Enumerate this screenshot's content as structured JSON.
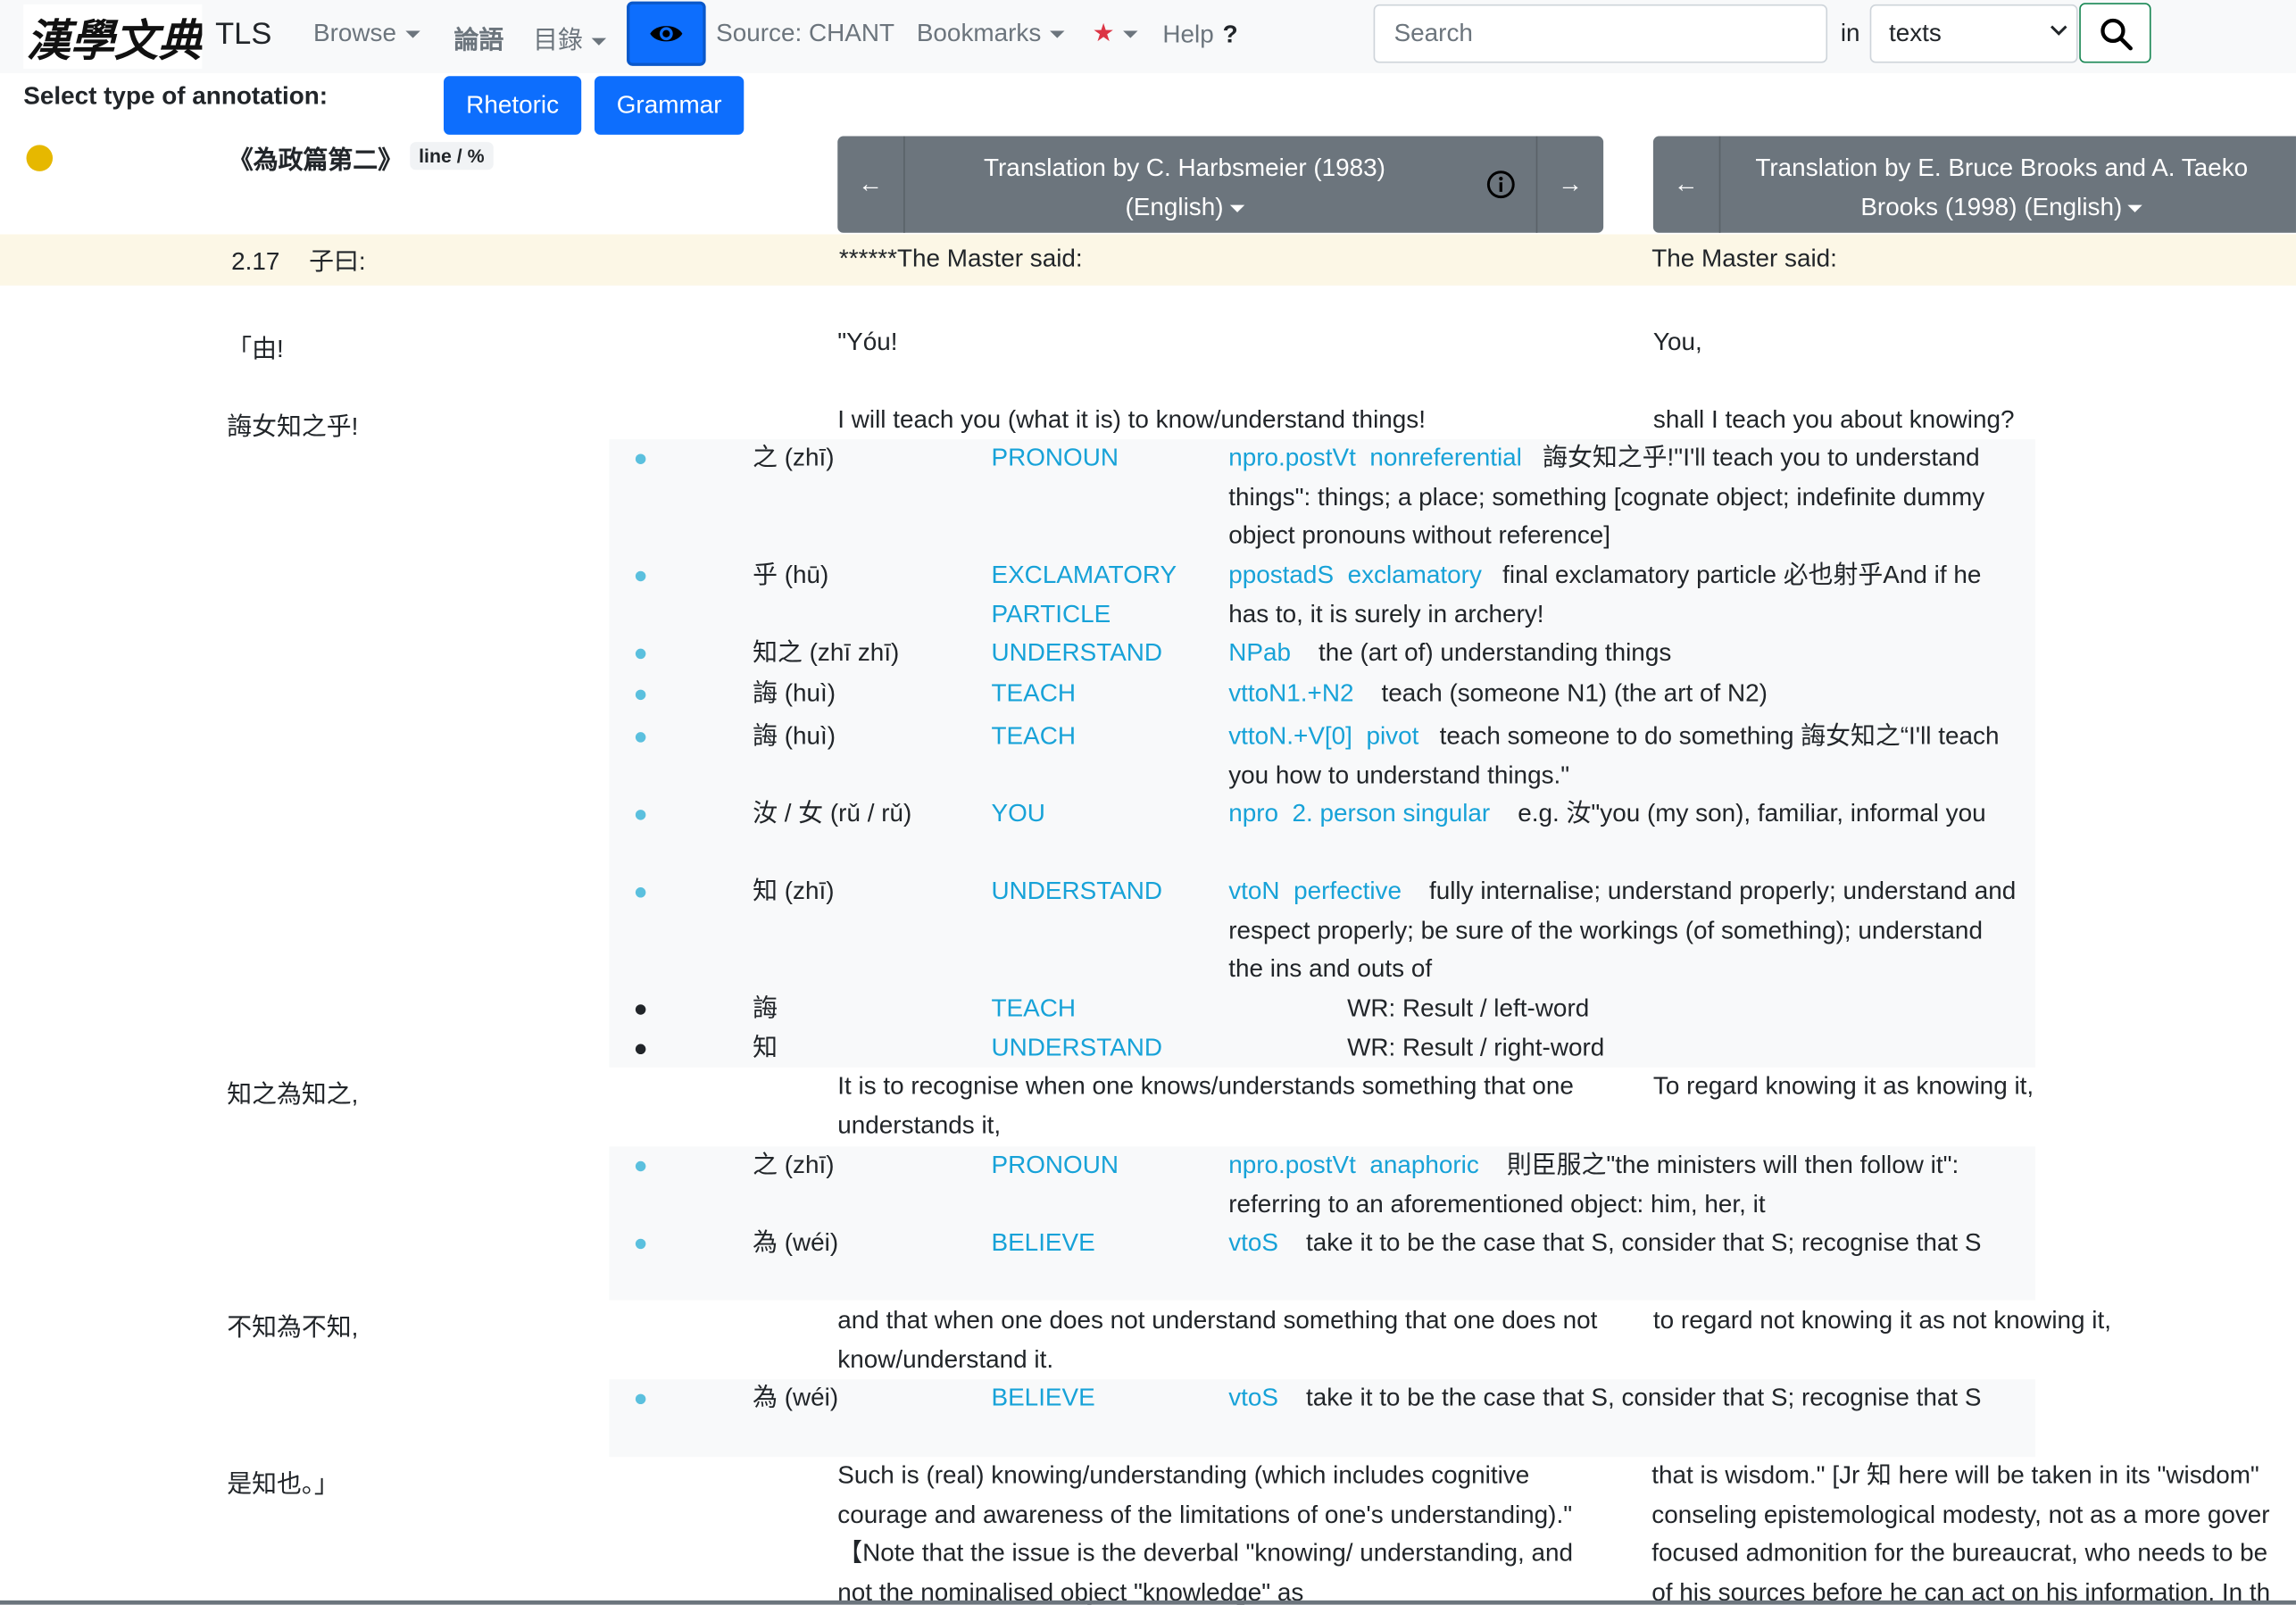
{
  "navbar": {
    "logo_text": "漢學文典",
    "brand": "TLS",
    "browse": "Browse",
    "lunyu": "論語",
    "toc": "目錄",
    "source": "Source: CHANT",
    "bookmarks": "Bookmarks",
    "star": "★",
    "help": "Help",
    "help_q": "?",
    "search_placeholder": "Search",
    "in_label": "in",
    "search_scope": "texts"
  },
  "annotation_bar": {
    "label": "Select type of annotation:",
    "rhetoric": "Rhetoric",
    "grammar": "Grammar"
  },
  "text_header": {
    "title": "《為政篇第二》",
    "badge": "line / %",
    "translation1": "Translation by C. Harbsmeier (1983) (English)",
    "translation1_line1": "Translation by C. Harbsmeier (1983)",
    "translation1_line2": "(English)",
    "translation2_line1": "Translation by E. Bruce Brooks and A. Taeko",
    "translation2_line2": "Brooks (1998) (English)",
    "arrow_left": "←",
    "arrow_right": "→"
  },
  "rows": {
    "r1": {
      "num": "2.17",
      "zh": "子曰:",
      "t1": "******The Master said:",
      "t2": "The Master said:"
    },
    "r2": {
      "zh": "「由!",
      "t1": "\"Yóu!",
      "t2": "You,"
    },
    "r3": {
      "zh": "誨女知之乎!",
      "t1": "I will teach you (what it is) to know/understand things!",
      "t2": "shall I teach you about knowing?"
    },
    "r4": {
      "zh": "知之為知之,",
      "t1": "It is to recognise when one knows/understands something that one understands it,",
      "t2": "To regard knowing it as knowing it,"
    },
    "r5": {
      "zh": "不知為不知,",
      "t1": "and that when one does not understand something that one does not know/understand it.",
      "t2": "to regard not knowing it as not knowing it,"
    },
    "r6": {
      "zh": "是知也。」",
      "t1": "Such is (real) knowing/understanding (which includes cognitive courage and awareness of the limitations of one's understanding).\"  【Note that the issue is the deverbal \"knowing/ understanding, and not the nominalised object \"knowledge\" as",
      "t2_l1": "that is wisdom.\"  [Jr 知 here will be taken in its \"wisdom\"",
      "t2_l2": "conseling epistemological modesty, not as a more gover",
      "t2_l3": "focused admonition for the bureaucrat, who needs to be",
      "t2_l4": "of his sources before he can act on his information. In th"
    }
  },
  "annotations_r3": [
    {
      "word": "之 (zhī)",
      "concept": "PRONOUN",
      "syn": "npro.postVt",
      "sem": "nonreferential",
      "def": "誨女知之乎!\"I'll teach you to understand  things\": things; a place; something [cognate object; indefinite dummy object pronouns without reference]"
    },
    {
      "word": "乎 (hū)",
      "concept": "EXCLAMATORY PARTICLE",
      "syn": "ppostadS",
      "sem": "exclamatory",
      "def": "final exclamatory particle 必也射乎And if he has to, it is surely in archery!"
    },
    {
      "word": "知之 (zhī zhī)",
      "concept": "UNDERSTAND",
      "syn": "NPab",
      "sem": "",
      "def": "the (art of) understanding things"
    },
    {
      "word": "誨 (huì)",
      "concept": "TEACH",
      "syn": "vttoN1.+N2",
      "sem": "",
      "def": "teach (someone N1) (the art of N2)"
    },
    {
      "word": "誨 (huì)",
      "concept": "TEACH",
      "syn": "vttoN.+V[0]",
      "sem": "pivot",
      "def": "teach someone to do something 誨女知之“I'll teach you how to understand things.\""
    },
    {
      "word": "汝 / 女 (rǔ / rǔ)",
      "concept": "YOU",
      "syn": "npro",
      "sem": "2. person singular",
      "def": "e.g. 汝\"you (my son), familiar, informal you"
    },
    {
      "word": "知 (zhī)",
      "concept": "UNDERSTAND",
      "syn": "vtoN",
      "sem": "perfective",
      "def": "fully internalise; understand properly; understand and respect properly; be sure of the workings (of something); understand the ins and outs of"
    },
    {
      "word": "誨",
      "concept": "TEACH",
      "wr": "WR: Result / left-word"
    },
    {
      "word": "知",
      "concept": "UNDERSTAND",
      "wr": "WR: Result / right-word"
    }
  ],
  "annotations_r4": [
    {
      "word": "之 (zhī)",
      "concept": "PRONOUN",
      "syn": "npro.postVt",
      "sem": "anaphoric",
      "def": "則臣服之\"the ministers will then follow it\": referring to an aforementioned object: him, her, it"
    },
    {
      "word": "為 (wéi)",
      "concept": "BELIEVE",
      "syn": "vtoS",
      "sem": "",
      "def": "take it to be the case that S, consider that S; recognise that S"
    }
  ],
  "annotations_r5": [
    {
      "word": "為 (wéi)",
      "concept": "BELIEVE",
      "syn": "vtoS",
      "sem": "",
      "def": "take it to be the case that S, consider that S; recognise that S"
    }
  ],
  "colors": {
    "primary": "#0d6efd",
    "link": "#17a2d8",
    "highlight_row": "#fcf7e6",
    "header_gray": "#6c757d",
    "dot": "#e6b800"
  }
}
